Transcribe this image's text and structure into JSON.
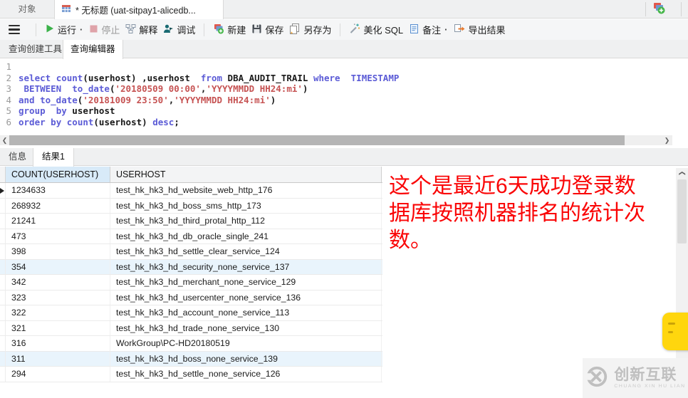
{
  "window_tabs": {
    "objects": "对象",
    "query": "* 无标题 (uat-sitpay1-alicedb..."
  },
  "toolbar": {
    "run": "运行",
    "run_more": "·",
    "stop": "停止",
    "explain": "解释",
    "debug": "调试",
    "new": "新建",
    "save": "保存",
    "save_as": "另存为",
    "beautify": "美化 SQL",
    "comment": "备注",
    "comment_more": "·",
    "export": "导出结果"
  },
  "editor_tabs": {
    "builder": "查询创建工具",
    "editor": "查询编辑器"
  },
  "sql_lines": [
    {
      "num": "1",
      "tokens": []
    },
    {
      "num": "2",
      "tokens": [
        {
          "t": "kw",
          "s": "select"
        },
        {
          "t": "pl",
          "s": " "
        },
        {
          "t": "kw",
          "s": "count"
        },
        {
          "t": "pl",
          "s": "(userhost) ,userhost  "
        },
        {
          "t": "kw",
          "s": "from"
        },
        {
          "t": "pl",
          "s": " DBA_AUDIT_TRAIL "
        },
        {
          "t": "kw",
          "s": "where"
        },
        {
          "t": "pl",
          "s": "  "
        },
        {
          "t": "kw",
          "s": "TIMESTAMP"
        }
      ]
    },
    {
      "num": "3",
      "tokens": [
        {
          "t": "pl",
          "s": " "
        },
        {
          "t": "kw",
          "s": "BETWEEN"
        },
        {
          "t": "pl",
          "s": "  "
        },
        {
          "t": "kw",
          "s": "to_date"
        },
        {
          "t": "pl",
          "s": "("
        },
        {
          "t": "str",
          "s": "'20180509 00:00'"
        },
        {
          "t": "pl",
          "s": ","
        },
        {
          "t": "str",
          "s": "'YYYYMMDD HH24:mi'"
        },
        {
          "t": "pl",
          "s": ")"
        }
      ]
    },
    {
      "num": "4",
      "tokens": [
        {
          "t": "kw",
          "s": "and"
        },
        {
          "t": "pl",
          "s": " "
        },
        {
          "t": "kw",
          "s": "to_date"
        },
        {
          "t": "pl",
          "s": "("
        },
        {
          "t": "str",
          "s": "'20181009 23:50'"
        },
        {
          "t": "pl",
          "s": ","
        },
        {
          "t": "str",
          "s": "'YYYYMMDD HH24:mi'"
        },
        {
          "t": "pl",
          "s": ")"
        }
      ]
    },
    {
      "num": "5",
      "tokens": [
        {
          "t": "kw",
          "s": "group"
        },
        {
          "t": "pl",
          "s": "  "
        },
        {
          "t": "kw",
          "s": "by"
        },
        {
          "t": "pl",
          "s": " userhost"
        }
      ]
    },
    {
      "num": "6",
      "tokens": [
        {
          "t": "kw",
          "s": "order"
        },
        {
          "t": "pl",
          "s": " "
        },
        {
          "t": "kw",
          "s": "by"
        },
        {
          "t": "pl",
          "s": " "
        },
        {
          "t": "kw",
          "s": "count"
        },
        {
          "t": "pl",
          "s": "(userhost) "
        },
        {
          "t": "kw",
          "s": "desc"
        },
        {
          "t": "pl",
          "s": ";"
        }
      ]
    }
  ],
  "result_tabs": {
    "info": "信息",
    "result": "结果1"
  },
  "table": {
    "columns": [
      "COUNT(USERHOST)",
      "USERHOST"
    ],
    "rows": [
      [
        "1234633",
        "test_hk_hk3_hd_website_web_http_176"
      ],
      [
        "268932",
        "test_hk_hk3_hd_boss_sms_http_173"
      ],
      [
        "21241",
        "test_hk_hk3_hd_third_protal_http_112"
      ],
      [
        "473",
        "test_hk_hk3_hd_db_oracle_single_241"
      ],
      [
        "398",
        "test_hk_hk3_hd_settle_clear_service_124"
      ],
      [
        "354",
        "test_hk_hk3_hd_security_none_service_137"
      ],
      [
        "342",
        "test_hk_hk3_hd_merchant_none_service_129"
      ],
      [
        "323",
        "test_hk_hk3_hd_usercenter_none_service_136"
      ],
      [
        "322",
        "test_hk_hk3_hd_account_none_service_113"
      ],
      [
        "321",
        "test_hk_hk3_hd_trade_none_service_130"
      ],
      [
        "316",
        "WorkGroup\\PC-HD20180519"
      ],
      [
        "311",
        "test_hk_hk3_hd_boss_none_service_139"
      ],
      [
        "294",
        "test_hk_hk3_hd_settle_none_service_126"
      ]
    ],
    "highlighted_rows": [
      5,
      11
    ],
    "current_row": 0
  },
  "annotation": {
    "lines": [
      "这个是最近6天成功登录数",
      "据库按照机器排名的统计次",
      "数。"
    ]
  },
  "watermark": {
    "title": "创新互联",
    "subtitle": "CHUANG XIN HU LIAN"
  },
  "colors": {
    "keyword": "#5b5bd6",
    "string": "#c65353",
    "annotation_red": "#fa0506",
    "header_selected": "#d8eaf8",
    "run_green": "#3bb24a",
    "export_orange": "#e87a2e",
    "sticker_yellow": "#ffd60e"
  }
}
